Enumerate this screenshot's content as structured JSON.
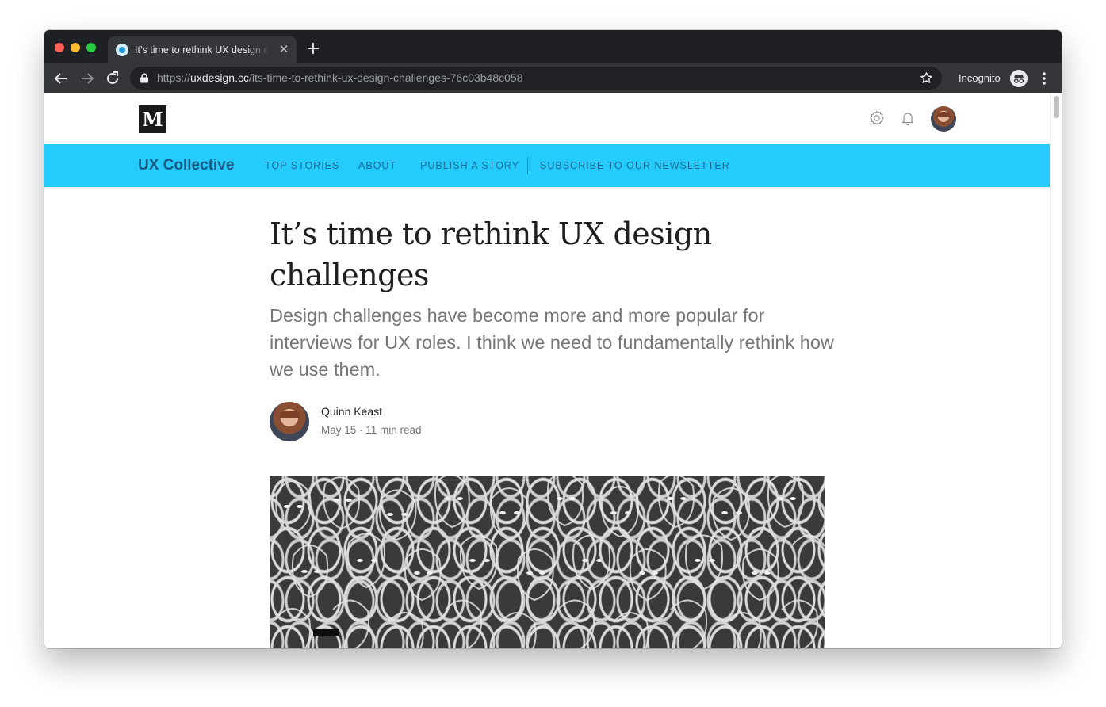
{
  "browser": {
    "tab": {
      "title": "It’s time to rethink UX design challenges – UX Collective"
    },
    "address_bar": {
      "scheme": "https://",
      "host": "uxdesign.cc",
      "path": "/its-time-to-rethink-ux-design-challenges-76c03b48c058"
    },
    "incognito_label": "Incognito"
  },
  "site": {
    "logo_letter": "M",
    "publication": {
      "name": "UX Collective",
      "nav": [
        "TOP STORIES",
        "ABOUT",
        "PUBLISH A STORY",
        "SUBSCRIBE TO OUR NEWSLETTER"
      ],
      "accent": "#24cbfc"
    }
  },
  "article": {
    "title": "It’s time to rethink UX design challenges",
    "subtitle": "Design challenges have become more and more popular for interviews for UX roles. I think we need to fundamentally rethink how we use them.",
    "author": "Quinn Keast",
    "meta": "May 15 · 11 min read"
  }
}
